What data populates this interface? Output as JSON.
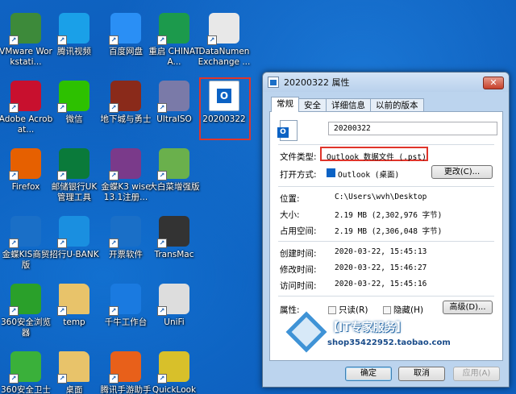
{
  "desktop": {
    "icons": [
      {
        "label": "VMware Workstati...",
        "icon": "vmware-icon",
        "color": "#3d8a3a"
      },
      {
        "label": "腾讯视频",
        "icon": "tencent-video-icon",
        "color": "#1aa0e8"
      },
      {
        "label": "百度网盘",
        "icon": "baidu-netdisk-icon",
        "color": "#2a8ff5"
      },
      {
        "label": "重启 CHINATA...",
        "icon": "restart-icon",
        "color": "#1c9a4c"
      },
      {
        "label": "DataNumen Exchange ...",
        "icon": "datanumen-icon",
        "color": "#e8e8e8"
      },
      {
        "label": "Adobe Acrobat...",
        "icon": "adobe-acrobat-icon",
        "color": "#c8102e"
      },
      {
        "label": "微信",
        "icon": "wechat-icon",
        "color": "#2dc100"
      },
      {
        "label": "地下城与勇士",
        "icon": "dnf-game-icon",
        "color": "#8a2a1a"
      },
      {
        "label": "UltraISO",
        "icon": "ultraiso-icon",
        "color": "#7a7aa8"
      },
      {
        "label": "20200322",
        "icon": "outlook-pst-file-icon",
        "color": "#ffffff"
      },
      {
        "label": "Firefox",
        "icon": "firefox-icon",
        "color": "#e66000"
      },
      {
        "label": "邮储银行UK 管理工具",
        "icon": "psbc-bank-icon",
        "color": "#0a7a3a"
      },
      {
        "label": "金蝶K3 wise 13.1注册...",
        "icon": "winrar-icon",
        "color": "#7a3a8a"
      },
      {
        "label": "大白菜增强版",
        "icon": "cabbage-icon",
        "color": "#6ab04c"
      },
      {
        "label": "金蝶KIS商贸 版",
        "icon": "kis-icon",
        "color": "#1a6fc7"
      },
      {
        "label": "招行U-BANK",
        "icon": "cmb-ubank-icon",
        "color": "#1a8fe0"
      },
      {
        "label": "开票软件",
        "icon": "invoice-icon",
        "color": "#1a6fc7"
      },
      {
        "label": "TransMac",
        "icon": "transmac-icon",
        "color": "#333333"
      },
      {
        "label": "360安全浏览 器",
        "icon": "360-browser-icon",
        "color": "#2aa02a"
      },
      {
        "label": "temp",
        "icon": "folder-icon",
        "color": "#e8c36a"
      },
      {
        "label": "千牛工作台",
        "icon": "qianniu-icon",
        "color": "#1a7ae0"
      },
      {
        "label": "UniFi",
        "icon": "unifi-icon",
        "color": "#dddddd"
      },
      {
        "label": "360安全卫士",
        "icon": "360-safe-icon",
        "color": "#3ab03a"
      },
      {
        "label": "桌面",
        "icon": "folder-icon",
        "color": "#e8c36a"
      },
      {
        "label": "腾讯手游助手",
        "icon": "tencent-game-icon",
        "color": "#e8601a"
      },
      {
        "label": "QuickLook",
        "icon": "quicklook-icon",
        "color": "#d8c02a"
      }
    ]
  },
  "dialog": {
    "title": "20200322 属性",
    "close": "✕",
    "tabs": [
      "常规",
      "安全",
      "详细信息",
      "以前的版本"
    ],
    "filename": "20200322",
    "file_type_label": "文件类型:",
    "file_type_value": "Outlook 数据文件 (.pst)",
    "open_with_label": "打开方式:",
    "open_with_value": "Outlook (桌面)",
    "change_button": "更改(C)...",
    "location_label": "位置:",
    "location_value": "C:\\Users\\wvh\\Desktop",
    "size_label": "大小:",
    "size_value": "2.19 MB (2,302,976 字节)",
    "disk_size_label": "占用空间:",
    "disk_size_value": "2.19 MB (2,306,048 字节)",
    "created_label": "创建时间:",
    "created_value": "2020-03-22, 15:45:13",
    "modified_label": "修改时间:",
    "modified_value": "2020-03-22, 15:46:27",
    "accessed_label": "访问时间:",
    "accessed_value": "2020-03-22, 15:45:16",
    "attributes_label": "属性:",
    "readonly_label": "只读(R)",
    "hidden_label": "隐藏(H)",
    "advanced_button": "高级(D)...",
    "ok_button": "确定",
    "cancel_button": "取消",
    "apply_button": "应用(A)"
  },
  "watermark": {
    "title": "【IT专家服务】",
    "url": "shop35422952.taobao.com"
  }
}
